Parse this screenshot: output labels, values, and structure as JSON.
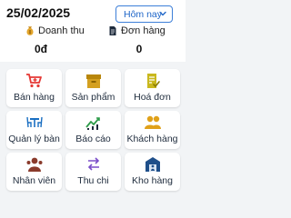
{
  "header": {
    "date": "25/02/2025",
    "period_select": {
      "selected": "Hôm nay"
    }
  },
  "stats": {
    "revenue": {
      "label": "Doanh thu",
      "value": "0đ"
    },
    "orders": {
      "label": "Đơn hàng",
      "value": "0"
    }
  },
  "menu": [
    {
      "label": "Bán hàng",
      "icon": "cart-plus-icon",
      "color": "#e53935"
    },
    {
      "label": "Sản phẩm",
      "icon": "box-icon",
      "color": "#c79a1a"
    },
    {
      "label": "Hoá đơn",
      "icon": "invoice-icon",
      "color": "#c9b81e"
    },
    {
      "label": "Quản lý bàn",
      "icon": "table-chairs-icon",
      "color": "#1a6fc2"
    },
    {
      "label": "Báo cáo",
      "icon": "chart-trend-icon",
      "color": "#2e9c4a"
    },
    {
      "label": "Khách hàng",
      "icon": "customers-icon",
      "color": "#e0a11a"
    },
    {
      "label": "Nhân viên",
      "icon": "staff-icon",
      "color": "#8a3b2c"
    },
    {
      "label": "Thu chi",
      "icon": "transfer-arrows-icon",
      "color": "#7b4fc9"
    },
    {
      "label": "Kho hàng",
      "icon": "warehouse-icon",
      "color": "#1f4f8a"
    }
  ]
}
